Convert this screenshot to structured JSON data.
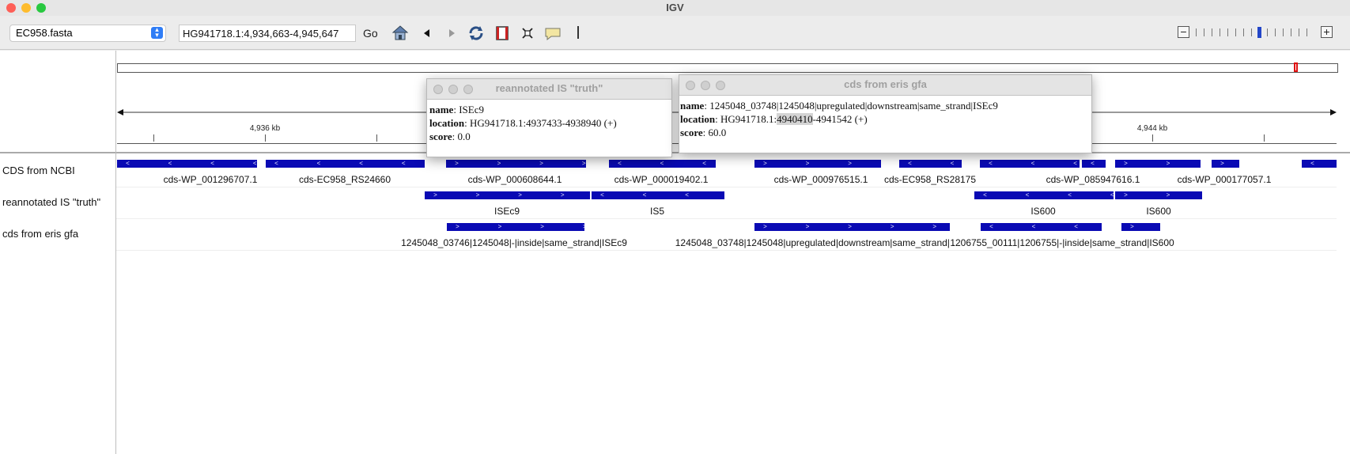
{
  "window": {
    "title": "IGV"
  },
  "colors": {
    "feature": "#0a0ab4",
    "overview_marker": "#e01010",
    "stepper": "#2f7df6"
  },
  "toolbar": {
    "genome": "EC958.fasta",
    "locus": "HG941718.1:4,934,663-4,945,647",
    "go_label": "Go",
    "icons": [
      "home-icon",
      "back-icon",
      "forward-icon",
      "refresh-icon",
      "roi-icon",
      "resize-icon",
      "popup-text-icon",
      "ruler-line-icon"
    ],
    "zoom_minus": "−",
    "zoom_plus": "+",
    "zoom_level_index": 8,
    "zoom_levels": 15
  },
  "ruler": {
    "ticks": [
      {
        "label": ""
      },
      {
        "label": "4,936 kb"
      },
      {
        "label": ""
      },
      {
        "label": ""
      },
      {
        "label": ""
      },
      {
        "label": ""
      },
      {
        "label": ""
      },
      {
        "label": ""
      },
      {
        "label": ""
      },
      {
        "label": "4,944 kb"
      },
      {
        "label": ""
      }
    ]
  },
  "tracks": [
    {
      "name": "CDS from NCBI",
      "labels": [
        "cds-WP_001296707.1",
        "cds-EC958_RS24660",
        "cds-WP_000608644.1",
        "cds-WP_000019402.1",
        "cds-WP_000976515.1",
        "cds-EC958_RS28175",
        "cds-WP_085947616.1",
        "cds-WP_000177057.1"
      ]
    },
    {
      "name": "reannotated IS \"truth\"",
      "labels": [
        "ISEc9",
        "IS5",
        "IS600",
        "IS600"
      ]
    },
    {
      "name": "cds from eris gfa",
      "labels": [
        "1245048_03746|1245048|-|inside|same_strand|ISEc9",
        "1245048_03748|1245048|upregulated|downstream|same_strand| ...",
        "1206755_00111|1206755|-|inside|same_strand|IS600"
      ]
    }
  ],
  "popups": [
    {
      "title": "reannotated IS \"truth\"",
      "name_key": "name",
      "name_val": "ISEc9",
      "location_key": "location",
      "location_val": "HG941718.1:4937433-4938940 (+)",
      "score_key": "score",
      "score_val": "0.0"
    },
    {
      "title": "cds from eris gfa",
      "name_key": "name",
      "name_val": "1245048_03748|1245048|upregulated|downstream|same_strand|ISEc9",
      "location_key": "location",
      "location_pre": "HG941718.1:",
      "location_hl": "4940410",
      "location_post": "-4941542 (+)",
      "score_key": "score",
      "score_val": "60.0"
    }
  ]
}
